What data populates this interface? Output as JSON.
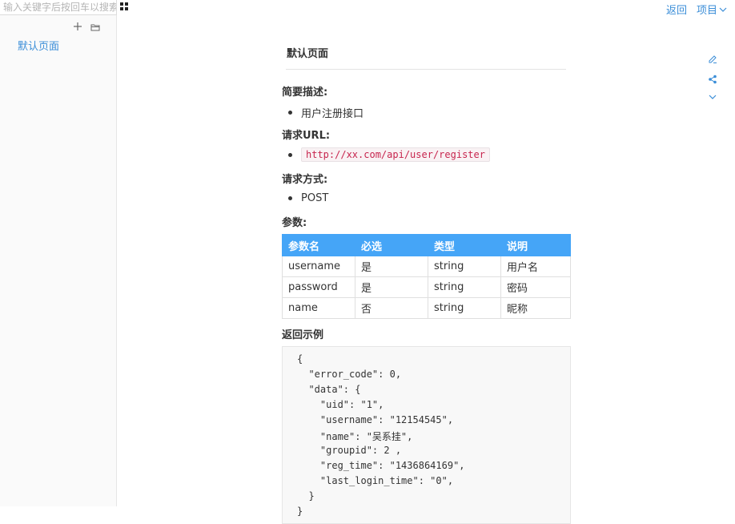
{
  "search": {
    "placeholder": "输入关键字后按回车以搜索"
  },
  "sidebar": {
    "items": [
      {
        "label": "默认页面"
      }
    ]
  },
  "topbar": {
    "back_label": "返回",
    "project_label": "项目"
  },
  "accent_color": "#3b8ed8",
  "table_header_color": "#45a5f7",
  "page": {
    "title": "默认页面",
    "summary_heading": "简要描述:",
    "summary_items": [
      "用户注册接口"
    ],
    "url_heading": "请求URL:",
    "url": "http://xx.com/api/user/register",
    "method_heading": "请求方式:",
    "method": "POST",
    "params_heading": "参数:",
    "params_table": {
      "headers": [
        "参数名",
        "必选",
        "类型",
        "说明"
      ],
      "rows": [
        [
          "username",
          "是",
          "string",
          "用户名"
        ],
        [
          "password",
          "是",
          "string",
          "密码"
        ],
        [
          "name",
          "否",
          "string",
          "昵称"
        ]
      ]
    },
    "example_heading": "返回示例",
    "example_lines": [
      "{",
      "  \"error_code\": 0,",
      "  \"data\": {",
      "    \"uid\": \"1\",",
      "    \"username\": \"12154545\",",
      "    \"name\": \"吴系挂\",",
      "    \"groupid\": 2 ,",
      "    \"reg_time\": \"1436864169\",",
      "    \"last_login_time\": \"0\",",
      "  }",
      "}"
    ]
  },
  "icons": {
    "grid": "grid-icon",
    "add": "plus-icon",
    "folder": "folder-icon",
    "edit": "pencil-icon",
    "share": "share-icon",
    "more": "chevron-down-icon"
  }
}
